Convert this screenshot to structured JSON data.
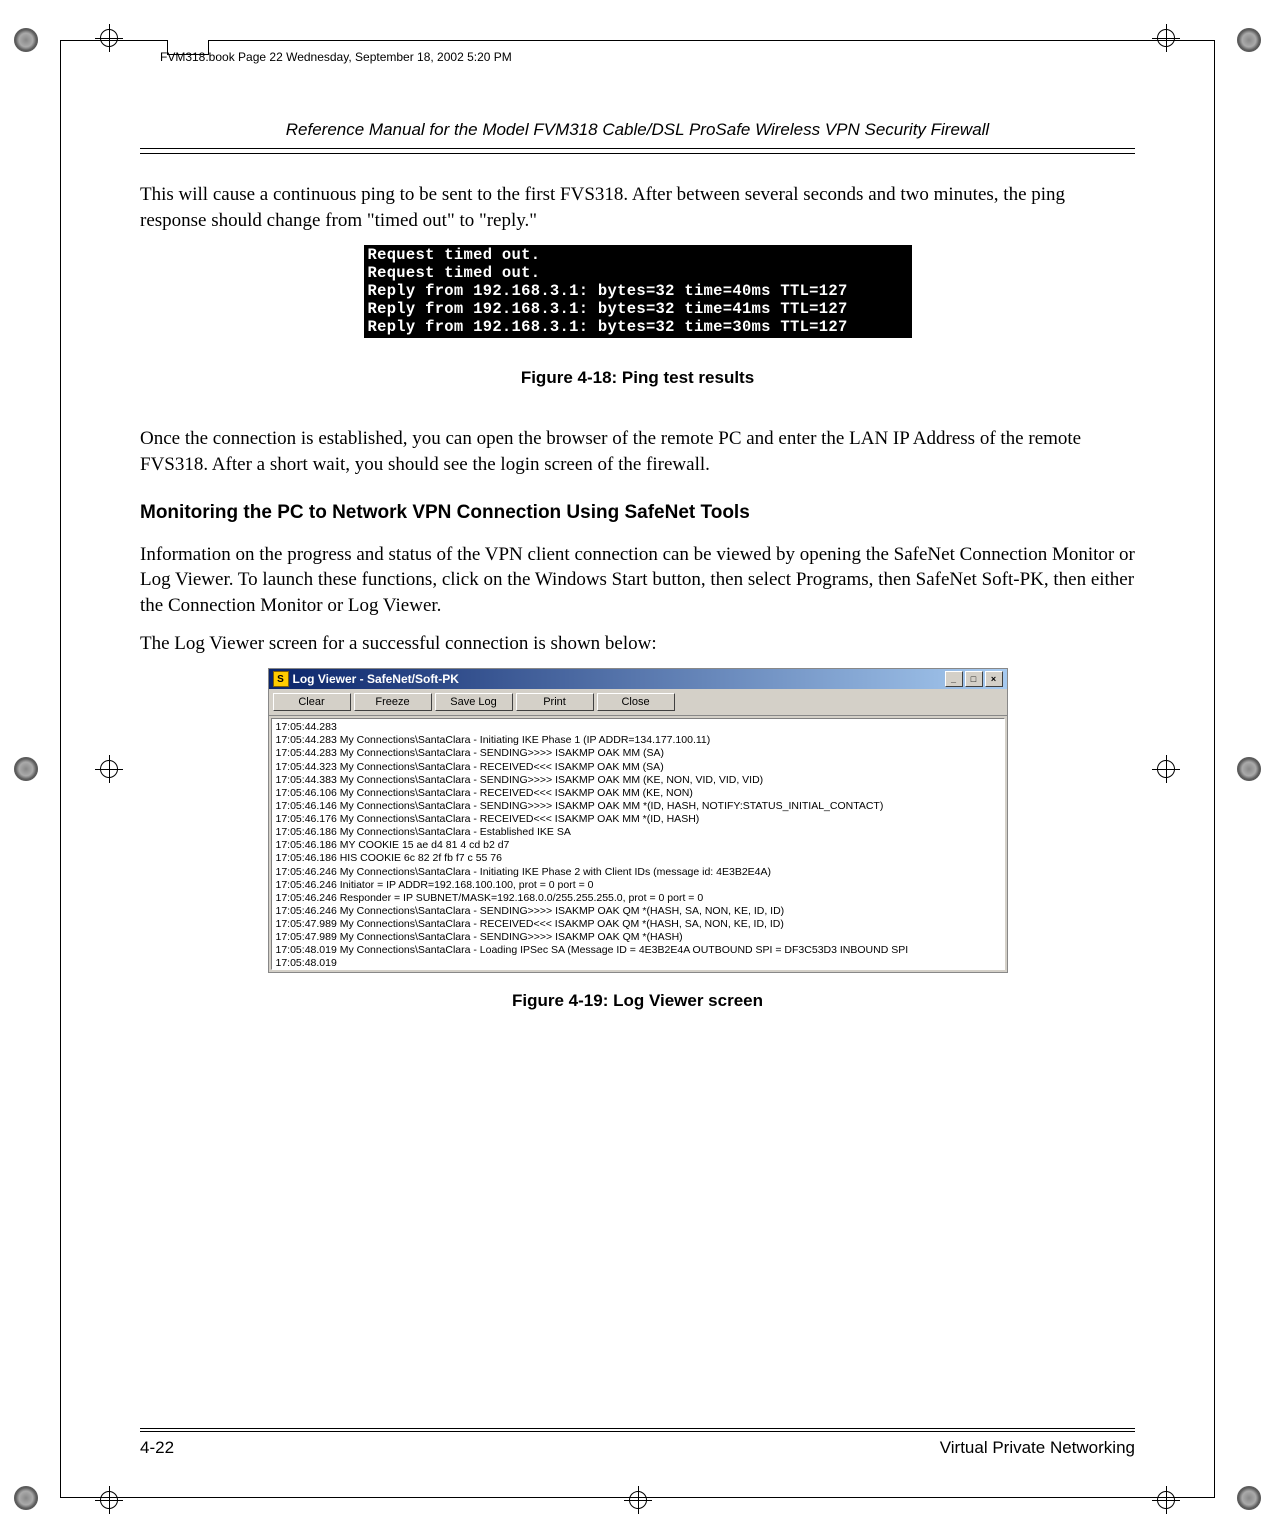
{
  "meta": {
    "book_info": "FVM318.book  Page 22  Wednesday, September 18, 2002  5:20 PM"
  },
  "header": {
    "running_title": "Reference Manual for the Model FVM318 Cable/DSL ProSafe Wireless VPN Security Firewall"
  },
  "body": {
    "para1": "This will cause a continuous ping to be sent to the first FVS318. After between several seconds and two minutes, the ping response should change from \"timed out\" to \"reply.\"",
    "terminal_lines": [
      "Request timed out.",
      "Request timed out.",
      "Reply from 192.168.3.1: bytes=32 time=40ms TTL=127",
      "Reply from 192.168.3.1: bytes=32 time=41ms TTL=127",
      "Reply from 192.168.3.1: bytes=32 time=30ms TTL=127"
    ],
    "figure_4_18": "Figure 4-18:  Ping test results",
    "para2": "Once the connection is established, you can open the browser of the remote PC and enter the LAN IP Address of the remote FVS318. After a short wait, you should see the login screen of the firewall.",
    "heading": "Monitoring the PC to Network VPN Connection Using SafeNet Tools",
    "para3": "Information on the progress and status of the VPN client connection can be viewed by opening the SafeNet Connection Monitor or Log Viewer. To launch these functions, click on the Windows Start button, then select Programs, then SafeNet Soft-PK, then either the Connection Monitor or Log Viewer.",
    "para4": "The Log Viewer screen for a successful connection is shown below:",
    "figure_4_19": "Figure 4-19:  Log Viewer screen"
  },
  "logviewer": {
    "title": "Log Viewer - SafeNet/Soft-PK",
    "icon_letter": "S",
    "buttons": {
      "clear": "Clear",
      "freeze": "Freeze",
      "save_log": "Save Log",
      "print": "Print",
      "close": "Close"
    },
    "winctl": {
      "min": "_",
      "max": "□",
      "close": "×"
    },
    "log_lines": [
      "17:05:44.283",
      "17:05:44.283 My Connections\\SantaClara - Initiating IKE Phase 1 (IP ADDR=134.177.100.11)",
      "17:05:44.283 My Connections\\SantaClara - SENDING>>>> ISAKMP OAK MM (SA)",
      "17:05:44.323 My Connections\\SantaClara - RECEIVED<<< ISAKMP OAK MM (SA)",
      "17:05:44.383 My Connections\\SantaClara - SENDING>>>> ISAKMP OAK MM (KE, NON, VID, VID, VID)",
      "17:05:46.106 My Connections\\SantaClara - RECEIVED<<< ISAKMP OAK MM (KE, NON)",
      "17:05:46.146 My Connections\\SantaClara - SENDING>>>> ISAKMP OAK MM *(ID, HASH, NOTIFY:STATUS_INITIAL_CONTACT)",
      "17:05:46.176 My Connections\\SantaClara - RECEIVED<<< ISAKMP OAK MM *(ID, HASH)",
      "17:05:46.186 My Connections\\SantaClara - Established IKE SA",
      "17:05:46.186    MY COOKIE 15 ae d4 81 4 cd b2 d7",
      "17:05:46.186    HIS COOKIE 6c 82 2f fb f7 c 55 76",
      "17:05:46.246 My Connections\\SantaClara - Initiating IKE Phase 2 with Client IDs (message id: 4E3B2E4A)",
      "17:05:46.246   Initiator = IP ADDR=192.168.100.100, prot = 0 port = 0",
      "17:05:46.246   Responder = IP SUBNET/MASK=192.168.0.0/255.255.255.0, prot = 0 port = 0",
      "17:05:46.246 My Connections\\SantaClara - SENDING>>>> ISAKMP OAK QM *(HASH, SA, NON, KE, ID, ID)",
      "17:05:47.989 My Connections\\SantaClara - RECEIVED<<< ISAKMP OAK QM *(HASH, SA, NON, KE, ID, ID)",
      "17:05:47.989 My Connections\\SantaClara - SENDING>>>> ISAKMP OAK QM *(HASH)",
      "17:05:48.019 My Connections\\SantaClara - Loading IPSec SA (Message ID = 4E3B2E4A OUTBOUND SPI = DF3C53D3 INBOUND SPI",
      "17:05:48.019"
    ]
  },
  "footer": {
    "page_num": "4-22",
    "chapter": "Virtual Private Networking"
  }
}
